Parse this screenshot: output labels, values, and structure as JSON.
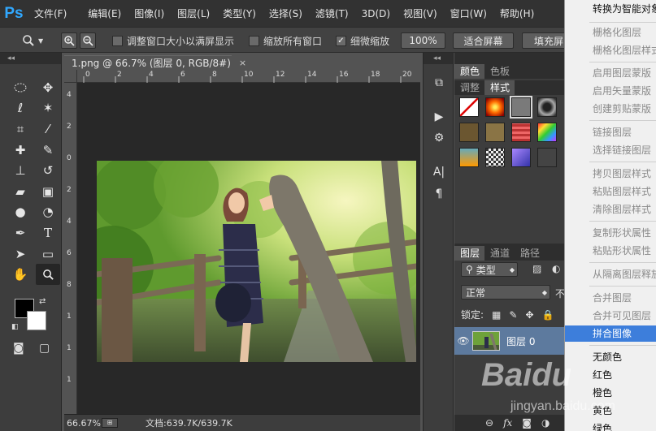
{
  "app": {
    "logo": "Ps"
  },
  "menubar": {
    "items": [
      "文件(F)",
      "编辑(E)",
      "图像(I)",
      "图层(L)",
      "类型(Y)",
      "选择(S)",
      "滤镜(T)",
      "3D(D)",
      "视图(V)",
      "窗口(W)",
      "帮助(H)"
    ]
  },
  "options": {
    "zoom_tool_icon": "magnifier-icon",
    "fit_window_label": "调整窗口大小以满屏显示",
    "fit_window_checked": false,
    "zoom_all_label": "缩放所有窗口",
    "zoom_all_checked": false,
    "scrubby_label": "细微缩放",
    "scrubby_checked": true,
    "btn_100": "100%",
    "btn_fit": "适合屏幕",
    "btn_fill": "填充屏"
  },
  "document": {
    "tab_title": "1.png @ 66.7% (图层 0, RGB/8#)",
    "close_glyph": "×",
    "ruler_h": [
      "0",
      "2",
      "4",
      "6",
      "8",
      "10",
      "12",
      "14",
      "16",
      "18",
      "20"
    ],
    "ruler_v": [
      "4",
      "2",
      "0",
      "2",
      "4",
      "6",
      "8",
      "1",
      "1",
      "1"
    ],
    "zoom": "66.67%",
    "doc_size": "文档:639.7K/639.7K"
  },
  "right_panel": {
    "tabs_top": [
      "颜色",
      "色板"
    ],
    "tabs_second": [
      "调整",
      "样式"
    ],
    "tabs_layers": [
      "图层",
      "通道",
      "路径"
    ],
    "kind_filter": "类型",
    "blend_mode": "正常",
    "opacity_label": "不",
    "lock_label": "锁定:",
    "layer_name": "图层 0"
  },
  "context_menu": {
    "items": [
      {
        "label": "转换为智能对象",
        "enabled": true
      },
      {
        "label": "栅格化图层",
        "enabled": false
      },
      {
        "label": "栅格化图层样式",
        "enabled": false
      },
      {
        "label": "启用图层蒙版",
        "enabled": false
      },
      {
        "label": "启用矢量蒙版",
        "enabled": false
      },
      {
        "label": "创建剪贴蒙版",
        "enabled": false
      },
      {
        "label": "链接图层",
        "enabled": false
      },
      {
        "label": "选择链接图层",
        "enabled": false
      },
      {
        "label": "拷贝图层样式",
        "enabled": false
      },
      {
        "label": "粘贴图层样式",
        "enabled": false
      },
      {
        "label": "清除图层样式",
        "enabled": false
      },
      {
        "label": "复制形状属性",
        "enabled": false
      },
      {
        "label": "粘贴形状属性",
        "enabled": false
      },
      {
        "label": "从隔离图层释放",
        "enabled": false
      },
      {
        "label": "合并图层",
        "enabled": false
      },
      {
        "label": "合并可见图层",
        "enabled": false
      },
      {
        "label": "拼合图像",
        "enabled": true,
        "highlighted": true
      },
      {
        "label": "无颜色",
        "enabled": true
      },
      {
        "label": "红色",
        "enabled": true
      },
      {
        "label": "橙色",
        "enabled": true
      },
      {
        "label": "黄色",
        "enabled": true
      },
      {
        "label": "绿色",
        "enabled": true
      }
    ]
  },
  "watermark": {
    "text": "Baidu",
    "subtext": "jingyan.baidu.com"
  },
  "colors": {
    "accent": "#3d7edb",
    "ps_blue": "#31a8ff",
    "highlight": "#3d7edb"
  }
}
